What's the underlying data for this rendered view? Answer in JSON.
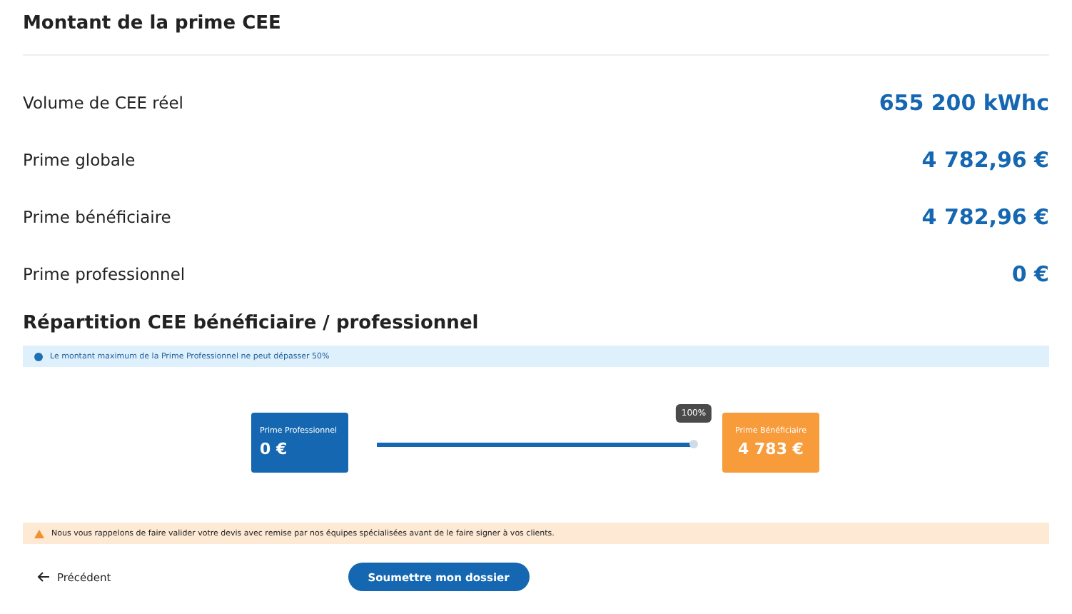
{
  "title": "Montant de la prime CEE",
  "rows": [
    {
      "label": "Volume de CEE réel",
      "value": "655 200 kWhc"
    },
    {
      "label": "Prime globale",
      "value": "4 782,96 €"
    },
    {
      "label": "Prime bénéficiaire",
      "value": "4 782,96 €"
    },
    {
      "label": "Prime professionnel",
      "value": "0 €"
    }
  ],
  "repartition": {
    "title": "Répartition CEE bénéficiaire / professionnel",
    "info": "Le montant maximum de la Prime Professionnel ne peut dépasser 50%",
    "left": {
      "label": "Prime Professionnel",
      "value": "0 €"
    },
    "slider": {
      "level": 1,
      "tooltip": "100%"
    },
    "right": {
      "label": "Prime Bénéficiaire",
      "value": "4 783 €"
    }
  },
  "warning": "Nous vous rappelons de faire valider votre devis avec remise par nos équipes spécialisées avant de le faire signer à vos clients.",
  "back": "Précédent",
  "submit": "Soumettre mon dossier"
}
